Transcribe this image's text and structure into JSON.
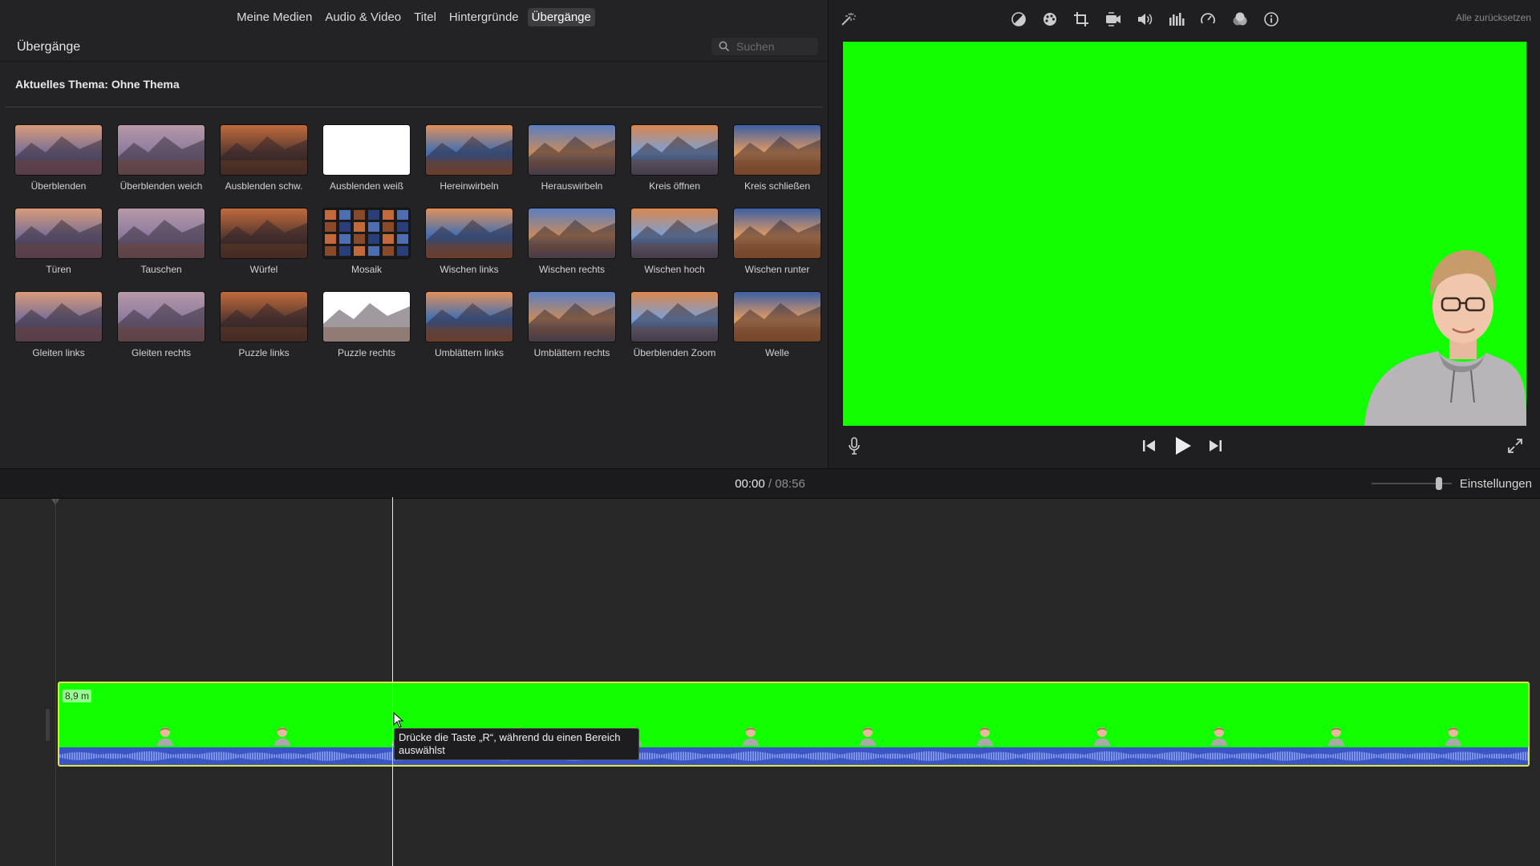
{
  "browser": {
    "tabs": [
      {
        "label": "Meine Medien",
        "active": false
      },
      {
        "label": "Audio & Video",
        "active": false
      },
      {
        "label": "Titel",
        "active": false
      },
      {
        "label": "Hintergründe",
        "active": false
      },
      {
        "label": "Übergänge",
        "active": true
      }
    ],
    "title": "Übergänge",
    "search_placeholder": "Suchen",
    "theme_label": "Aktuelles Thema: Ohne Thema",
    "transitions": [
      {
        "label": "Überblenden"
      },
      {
        "label": "Überblenden weich"
      },
      {
        "label": "Ausblenden schw."
      },
      {
        "label": "Ausblenden weiß"
      },
      {
        "label": "Hereinwirbeln"
      },
      {
        "label": "Herauswirbeln"
      },
      {
        "label": "Kreis öffnen"
      },
      {
        "label": "Kreis schließen"
      },
      {
        "label": "Türen"
      },
      {
        "label": "Tauschen"
      },
      {
        "label": "Würfel"
      },
      {
        "label": "Mosaik"
      },
      {
        "label": "Wischen links"
      },
      {
        "label": "Wischen rechts"
      },
      {
        "label": "Wischen hoch"
      },
      {
        "label": "Wischen runter"
      },
      {
        "label": "Gleiten links"
      },
      {
        "label": "Gleiten rechts"
      },
      {
        "label": "Puzzle links"
      },
      {
        "label": "Puzzle rechts"
      },
      {
        "label": "Umblättern links"
      },
      {
        "label": "Umblättern rechts"
      },
      {
        "label": "Überblenden Zoom"
      },
      {
        "label": "Welle"
      }
    ]
  },
  "viewer": {
    "reset_label": "Alle zurücksetzen",
    "tools": [
      "magic-wand-icon",
      "color-balance-icon",
      "color-correction-icon",
      "crop-icon",
      "stabilization-icon",
      "volume-icon",
      "equalizer-icon",
      "speed-icon",
      "clip-filter-icon",
      "info-icon"
    ],
    "preview_bg": "#12ff00"
  },
  "timeline": {
    "current_time": "00:00",
    "separator": "/",
    "total_time": "08:56",
    "settings_label": "Einstellungen",
    "clip_duration": "8,9 m",
    "clip_color": "#12ff00",
    "clip_border": "#e7e44a",
    "audio_color": "#3a55c4",
    "tooltip": "Drücke die Taste „R“, während du einen Bereich auswählst"
  }
}
